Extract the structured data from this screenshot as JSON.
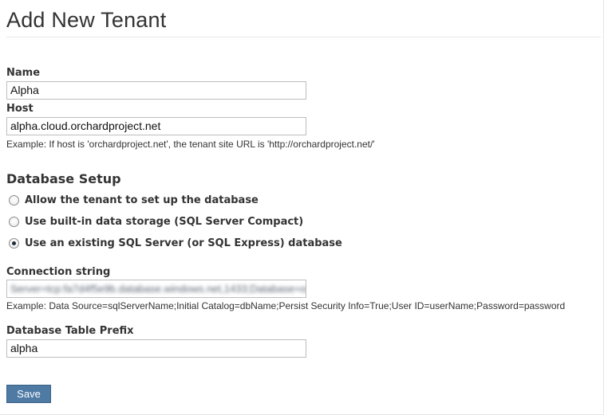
{
  "page": {
    "title": "Add New Tenant"
  },
  "form": {
    "name": {
      "label": "Name",
      "value": "Alpha"
    },
    "host": {
      "label": "Host",
      "value": "alpha.cloud.orchardproject.net",
      "hint": "Example: If host is 'orchardproject.net', the tenant site URL is 'http://orchardproject.net/'"
    },
    "database_setup": {
      "title": "Database Setup",
      "options": [
        {
          "label": "Allow the tenant to set up the database",
          "checked": false
        },
        {
          "label": "Use built-in data storage (SQL Server Compact)",
          "checked": false
        },
        {
          "label": "Use an existing SQL Server (or SQL Express) database",
          "checked": true
        }
      ]
    },
    "connection_string": {
      "label": "Connection string",
      "value": "Server=tcp:fa7d4f5e9b.database.windows.net,1433;Database=orchard",
      "hint": "Example: Data Source=sqlServerName;Initial Catalog=dbName;Persist Security Info=True;User ID=userName;Password=password"
    },
    "table_prefix": {
      "label": "Database Table Prefix",
      "value": "alpha"
    },
    "save_label": "Save"
  }
}
